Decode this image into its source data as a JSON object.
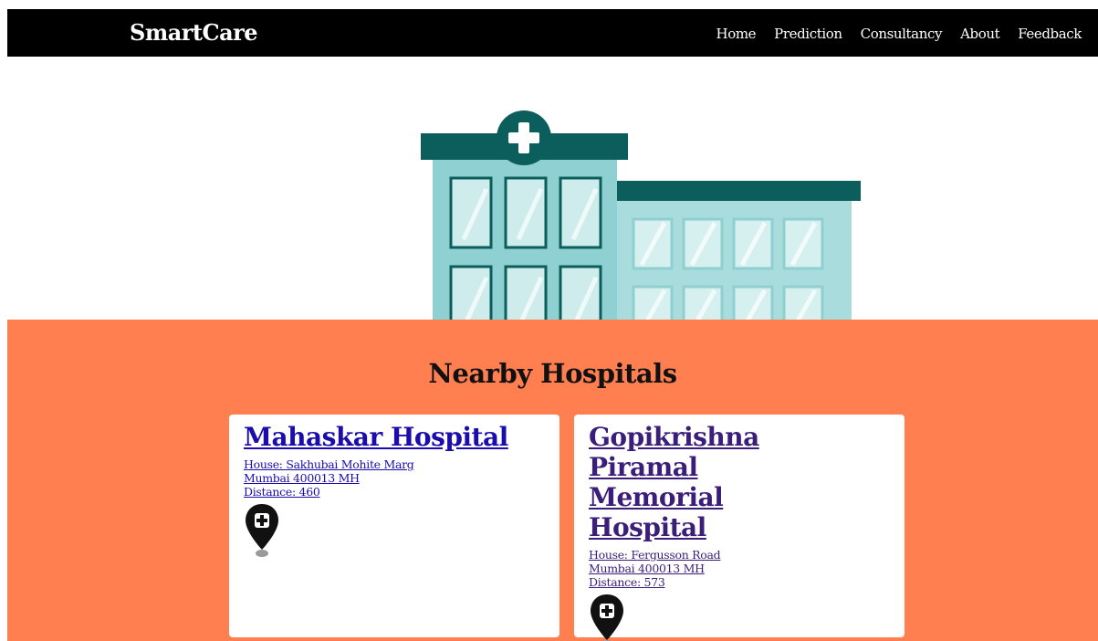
{
  "header": {
    "brand": "SmartCare",
    "nav": [
      "Home",
      "Prediction",
      "Consultancy",
      "About",
      "Feedback"
    ]
  },
  "hero": {
    "image": "hospital-building-illustration"
  },
  "section": {
    "title": "Nearby Hospitals",
    "background": "#ff7f50"
  },
  "hospitals": [
    {
      "name": "Mahaskar Hospital",
      "address_line1": "House: Sakhubai Mohite Marg",
      "address_line2": "Mumbai 400013 MH",
      "distance": "Distance: 460",
      "icon": "hospital-map-pin-icon"
    },
    {
      "name": "Gopikrishna Piramal Memorial Hospital",
      "address_line1": "House: Fergusson Road",
      "address_line2": "Mumbai 400013 MH",
      "distance": "Distance: 573",
      "icon": "hospital-map-pin-icon"
    }
  ],
  "colors": {
    "navbar": "#000000",
    "link": "#1a0dab",
    "visited_link": "#3b1e7a",
    "building_dark": "#0b5e5c",
    "building_light": "#8fd1d2"
  }
}
